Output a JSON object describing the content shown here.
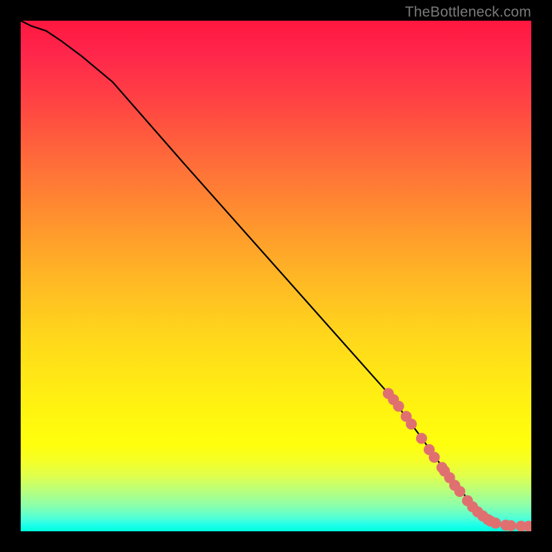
{
  "watermark": "TheBottleneck.com",
  "chart_data": {
    "type": "line",
    "title": "",
    "xlabel": "",
    "ylabel": "",
    "xlim": [
      0,
      100
    ],
    "ylim": [
      0,
      100
    ],
    "grid": false,
    "series": [
      {
        "name": "curve",
        "color": "#000000",
        "x": [
          0,
          2,
          5,
          8,
          12,
          18,
          25,
          32,
          40,
          48,
          56,
          64,
          72,
          78,
          83,
          87,
          90,
          92,
          94,
          96,
          98,
          100
        ],
        "y": [
          100,
          99,
          98,
          96,
          93,
          88,
          80,
          72,
          63,
          54,
          45,
          36,
          27,
          19,
          12,
          7,
          4,
          2.5,
          1.5,
          1,
          1,
          1
        ]
      }
    ],
    "scatter_points": {
      "name": "dots",
      "color": "#e07070",
      "radius": 8,
      "points": [
        {
          "x": 72.0,
          "y": 27.0
        },
        {
          "x": 73.0,
          "y": 25.8
        },
        {
          "x": 74.0,
          "y": 24.5
        },
        {
          "x": 75.5,
          "y": 22.5
        },
        {
          "x": 76.5,
          "y": 21.0
        },
        {
          "x": 78.5,
          "y": 18.2
        },
        {
          "x": 80.0,
          "y": 16.0
        },
        {
          "x": 81.0,
          "y": 14.5
        },
        {
          "x": 82.5,
          "y": 12.5
        },
        {
          "x": 83.0,
          "y": 11.8
        },
        {
          "x": 84.0,
          "y": 10.5
        },
        {
          "x": 85.0,
          "y": 9.0
        },
        {
          "x": 86.0,
          "y": 7.8
        },
        {
          "x": 87.5,
          "y": 6.0
        },
        {
          "x": 88.5,
          "y": 4.8
        },
        {
          "x": 89.5,
          "y": 3.8
        },
        {
          "x": 90.5,
          "y": 3.0
        },
        {
          "x": 91.5,
          "y": 2.3
        },
        {
          "x": 92.0,
          "y": 2.0
        },
        {
          "x": 93.0,
          "y": 1.6
        },
        {
          "x": 95.0,
          "y": 1.2
        },
        {
          "x": 96.0,
          "y": 1.1
        },
        {
          "x": 98.0,
          "y": 1.0
        },
        {
          "x": 99.5,
          "y": 1.0
        }
      ]
    }
  }
}
